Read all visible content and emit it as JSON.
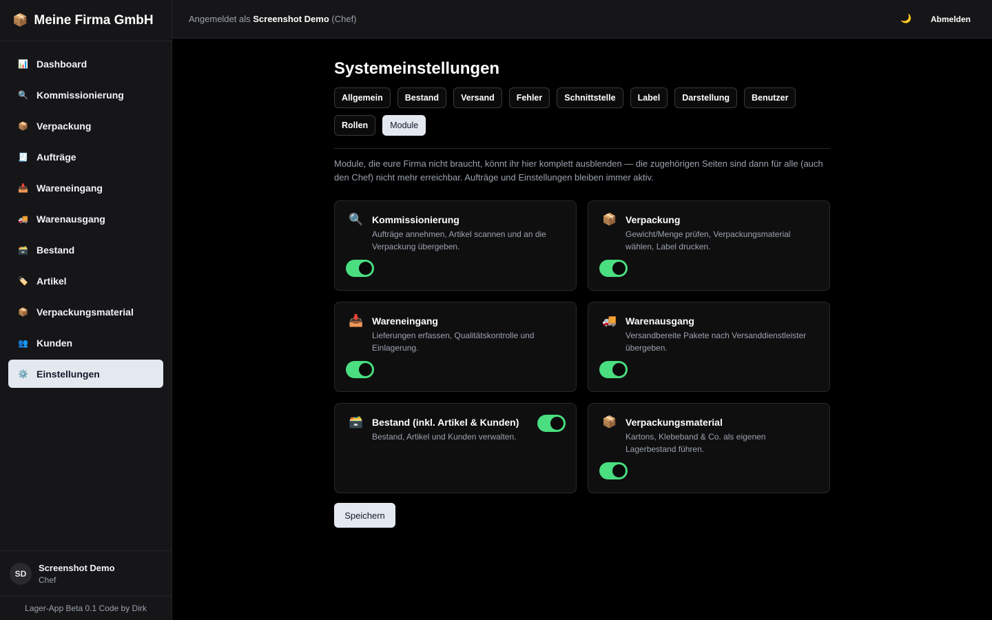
{
  "brand": {
    "icon": "package-icon",
    "emoji": "📦",
    "name": "Meine Firma GmbH"
  },
  "sidebar": {
    "items": [
      {
        "label": "Dashboard",
        "icon": "chart-icon",
        "emoji": "📊",
        "active": false
      },
      {
        "label": "Kommissionierung",
        "icon": "magnifier-icon",
        "emoji": "🔍",
        "active": false
      },
      {
        "label": "Verpackung",
        "icon": "package-icon",
        "emoji": "📦",
        "active": false
      },
      {
        "label": "Aufträge",
        "icon": "receipt-icon",
        "emoji": "🧾",
        "active": false
      },
      {
        "label": "Wareneingang",
        "icon": "inbox-icon",
        "emoji": "📥",
        "active": false
      },
      {
        "label": "Warenausgang",
        "icon": "truck-icon",
        "emoji": "🚚",
        "active": false
      },
      {
        "label": "Bestand",
        "icon": "card-box-icon",
        "emoji": "🗃️",
        "active": false
      },
      {
        "label": "Artikel",
        "icon": "tag-icon",
        "emoji": "🏷️",
        "active": false
      },
      {
        "label": "Verpackungsmaterial",
        "icon": "package-icon",
        "emoji": "📦",
        "active": false
      },
      {
        "label": "Kunden",
        "icon": "users-icon",
        "emoji": "👥",
        "active": false
      },
      {
        "label": "Einstellungen",
        "icon": "gear-icon",
        "emoji": "⚙️",
        "active": true
      }
    ]
  },
  "user": {
    "initials": "SD",
    "name": "Screenshot Demo",
    "role": "Chef"
  },
  "footer": {
    "text": "Lager-App Beta 0.1 Code by Dirk"
  },
  "topbar": {
    "signed_in_prefix": "Angemeldet als ",
    "signed_in_name": "Screenshot Demo",
    "signed_in_role": " (Chef)",
    "theme_icon": "moon-icon",
    "theme_emoji": "🌙",
    "logout_label": "Abmelden"
  },
  "main": {
    "title": "Systemeinstellungen",
    "tabs": [
      {
        "label": "Allgemein",
        "active": false
      },
      {
        "label": "Bestand",
        "active": false
      },
      {
        "label": "Versand",
        "active": false
      },
      {
        "label": "Fehler",
        "active": false
      },
      {
        "label": "Schnittstelle",
        "active": false
      },
      {
        "label": "Label",
        "active": false
      },
      {
        "label": "Darstellung",
        "active": false
      },
      {
        "label": "Benutzer",
        "active": false
      },
      {
        "label": "Rollen",
        "active": false
      },
      {
        "label": "Module",
        "active": true
      }
    ],
    "intro": "Module, die eure Firma nicht braucht, könnt ihr hier komplett ausblenden — die zugehörigen Seiten sind dann für alle (auch den Chef) nicht mehr erreichbar. Aufträge und Einstellungen bleiben immer aktiv.",
    "modules": [
      {
        "title": "Kommissionierung",
        "icon": "magnifier-icon",
        "emoji": "🔍",
        "description": "Aufträge annehmen, Artikel scannen und an die Verpackung übergeben.",
        "enabled": true
      },
      {
        "title": "Verpackung",
        "icon": "package-icon",
        "emoji": "📦",
        "description": "Gewicht/Menge prüfen, Verpackungsmaterial wählen, Label drucken.",
        "enabled": true
      },
      {
        "title": "Wareneingang",
        "icon": "inbox-icon",
        "emoji": "📥",
        "description": "Lieferungen erfassen, Qualitätskontrolle und Einlagerung.",
        "enabled": true
      },
      {
        "title": "Warenausgang",
        "icon": "truck-icon",
        "emoji": "🚚",
        "description": "Versandbereite Pakete nach Versanddienstleister übergeben.",
        "enabled": true
      },
      {
        "title": "Bestand (inkl. Artikel & Kunden)",
        "icon": "card-box-icon",
        "emoji": "🗃️",
        "description": "Bestand, Artikel und Kunden verwalten.",
        "enabled": true
      },
      {
        "title": "Verpackungsmaterial",
        "icon": "package-icon",
        "emoji": "📦",
        "description": "Kartons, Klebeband & Co. als eigenen Lagerbestand führen.",
        "enabled": true
      }
    ],
    "save_label": "Speichern"
  },
  "colors": {
    "accent_toggle": "#4ade80",
    "active_bg": "#e4e8ef",
    "background": "#000000",
    "panel": "#161618"
  }
}
